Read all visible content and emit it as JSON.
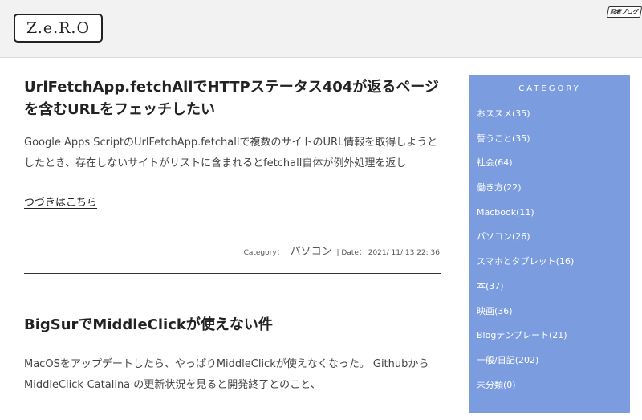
{
  "header": {
    "logo_text": "Z.e.R.O",
    "badge_text": "忍者ブログ"
  },
  "posts": [
    {
      "title": "UrlFetchApp.fetchAllでHTTPステータス404が返るページを含むURLをフェッチしたい",
      "excerpt": "Google Apps ScriptのUrlFetchApp.fetchallで複数のサイトのURL情報を取得しようとしたとき、存在しないサイトがリストに含まれるとfetchall自体が例外処理を返し",
      "read_more": "つづきはこちら",
      "category_label": "Category：",
      "category": "パソコン",
      "date_label": "| Date：",
      "date": "2021/ 11/ 13 22: 36"
    },
    {
      "title": "BigSurでMiddleClickが使えない件",
      "excerpt": "MacOSをアップデートしたら、やっぱりMiddleClickが使えなくなった。 Githubから MiddleClick-Catalina の更新状況を見ると開発終了とのこと、"
    }
  ],
  "sidebar": {
    "title": "CATEGORY",
    "categories": [
      "おススメ(35)",
      "誓うこと(35)",
      "社会(64)",
      "働き方(22)",
      "Macbook(11)",
      "パソコン(26)",
      "スマホとタブレット(16)",
      "本(37)",
      "映画(36)",
      "Blogテンプレート(21)",
      "一般/日記(202)",
      "未分類(0)"
    ]
  },
  "colors": {
    "sidebar_bg": "#7b9de0",
    "header_bg": "#f2f2f2"
  }
}
